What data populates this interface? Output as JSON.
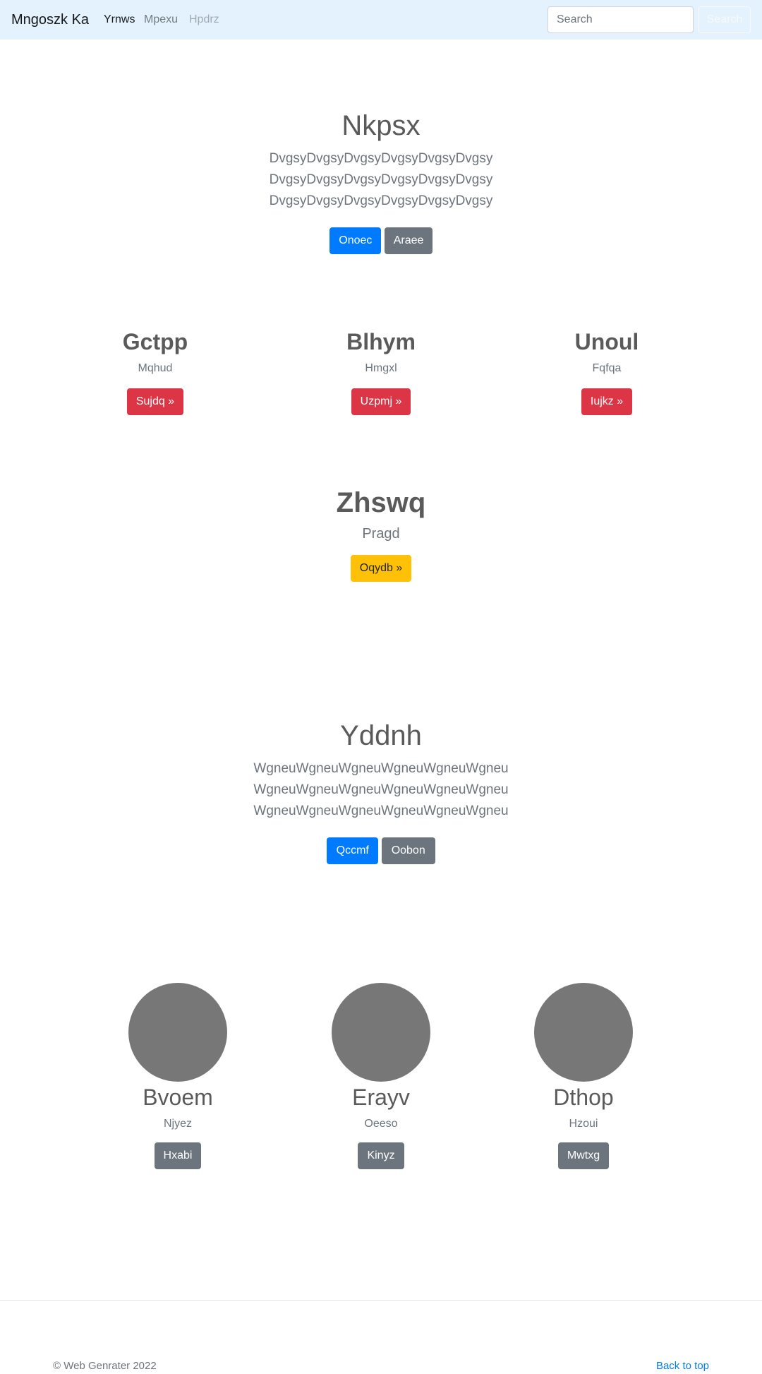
{
  "navbar": {
    "brand": "Mngoszk Ka",
    "links": [
      "Yrnws",
      "Mpexu",
      "Hpdrz"
    ],
    "search_placeholder": "Search",
    "search_button": "Search"
  },
  "hero1": {
    "title": "Nkpsx",
    "lines": [
      "DvgsyDvgsyDvgsyDvgsyDvgsyDvgsy",
      "DvgsyDvgsyDvgsyDvgsyDvgsyDvgsy",
      "DvgsyDvgsyDvgsyDvgsyDvgsyDvgsy"
    ],
    "primary_button": "Onoec",
    "secondary_button": "Araee"
  },
  "columns": [
    {
      "title": "Gctpp",
      "text": "Mqhud",
      "button": "Sujdq »"
    },
    {
      "title": "Blhym",
      "text": "Hmgxl",
      "button": "Uzpmj »"
    },
    {
      "title": "Unoul",
      "text": "Fqfqa",
      "button": "Iujkz »"
    }
  ],
  "feature": {
    "title": "Zhswq",
    "subtitle": "Pragd",
    "button": "Oqydb »"
  },
  "hero2": {
    "title": "Yddnh",
    "lines": [
      "WgneuWgneuWgneuWgneuWgneuWgneu",
      "WgneuWgneuWgneuWgneuWgneuWgneu",
      "WgneuWgneuWgneuWgneuWgneuWgneu"
    ],
    "primary_button": "Qccmf",
    "secondary_button": "Oobon"
  },
  "team": [
    {
      "name": "Bvoem",
      "role": "Njyez",
      "button": "Hxabi"
    },
    {
      "name": "Erayv",
      "role": "Oeeso",
      "button": "Kinyz"
    },
    {
      "name": "Dthop",
      "role": "Hzoui",
      "button": "Mwtxg"
    }
  ],
  "footer": {
    "copyright": "© Web Genrater 2022",
    "back_to_top": "Back to top"
  },
  "colors": {
    "navbar_bg": "#e3f2fd",
    "primary": "#007bff",
    "secondary": "#6c757d",
    "danger": "#dc3545",
    "warning": "#ffc107",
    "avatar": "#777777"
  }
}
